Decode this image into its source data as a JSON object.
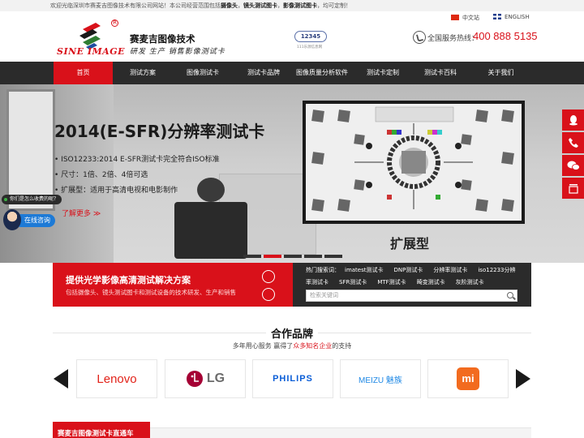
{
  "topbar": {
    "welcome_prefix": "欢迎光临深圳市赛麦吉图像技术有限公司网站！本公司经营范围包括",
    "welcome_b1": "摄像头",
    "welcome_sep1": "，",
    "welcome_b2": "镜头测试图卡",
    "welcome_sep2": "，",
    "welcome_b3": "影像测试图卡",
    "welcome_suffix": "，均可定制！"
  },
  "header": {
    "logo_text": "SINE IMAGE",
    "reg_mark": "R",
    "company_name": "赛麦吉图像技术",
    "slogan": "研发 生产 销售影像测试卡",
    "badge_12345": "12345",
    "badge_sub": "111乐源信息网",
    "lang_cn": "中文站",
    "lang_en": "ENGLISH",
    "hotline_label": "全国服务热线：",
    "hotline_number": "400 888 5135"
  },
  "nav": {
    "items": [
      "首页",
      "测试方案",
      "图像测试卡",
      "测试卡品牌",
      "图像质量分析软件",
      "测试卡定制",
      "测试卡百科",
      "关于我们"
    ]
  },
  "banner": {
    "title": "2014(E-SFR)分辨率测试卡",
    "bullets": [
      "ISO12233:2014 E-SFR测试卡完全符合ISO标准",
      "尺寸：1倍、2倍、4倍可选",
      "扩展型：适用于高清电视和电影制作"
    ],
    "learn_more": "了解更多 ≫",
    "chart_label": "扩展型"
  },
  "chat": {
    "question": "你们是怎么收费的呢？",
    "consult": "在线咨询"
  },
  "float_bar": {
    "icons": [
      "qq-icon",
      "phone-icon",
      "wechat-icon",
      "top-icon"
    ]
  },
  "solutions": {
    "title": "提供光学影像高清测试解决方案",
    "desc": "包括摄像头、镜头测试图卡和测试设备的技术研发、生产和销售"
  },
  "hot_search": {
    "label": "热门搜索词：",
    "row1": [
      "imatest测试卡",
      "DNP测试卡",
      "分辨率测试卡",
      "iso12233分辨"
    ],
    "row2": [
      "率测试卡",
      "SFR测试卡",
      "MTF测试卡",
      "畸变测试卡",
      "灰阶测试卡"
    ],
    "placeholder": "检索关键词"
  },
  "partners": {
    "title": "合作品牌",
    "sub_prefix": "多年用心服务 赢得了",
    "sub_highlight": "众多知名企业",
    "sub_suffix": "的支持",
    "brands": [
      "Lenovo",
      "LG",
      "PHILIPS",
      "MEIZU 魅族",
      "mi"
    ]
  },
  "bottom": {
    "red_title": "赛麦吉图像测试卡直通车"
  },
  "colors": {
    "brand_red": "#d9111a",
    "nav_dark": "#2b2b2b"
  }
}
